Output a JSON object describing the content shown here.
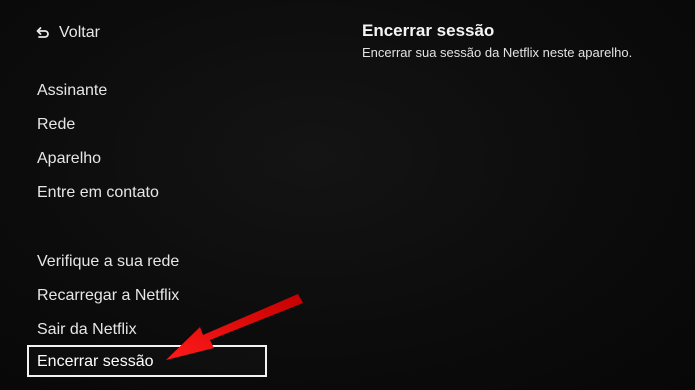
{
  "back": {
    "label": "Voltar",
    "icon": "back-arrow-icon"
  },
  "menu_group_1": [
    {
      "label": "Assinante"
    },
    {
      "label": "Rede"
    },
    {
      "label": "Aparelho"
    },
    {
      "label": "Entre em contato"
    }
  ],
  "menu_group_2": [
    {
      "label": "Verifique a sua rede"
    },
    {
      "label": "Recarregar a Netflix"
    },
    {
      "label": "Sair da Netflix"
    }
  ],
  "selected_item": {
    "label": "Encerrar sessão"
  },
  "detail": {
    "title": "Encerrar sessão",
    "description": "Encerrar sua sessão da Netflix neste aparelho."
  },
  "annotation": {
    "arrow_color": "#e50914"
  }
}
